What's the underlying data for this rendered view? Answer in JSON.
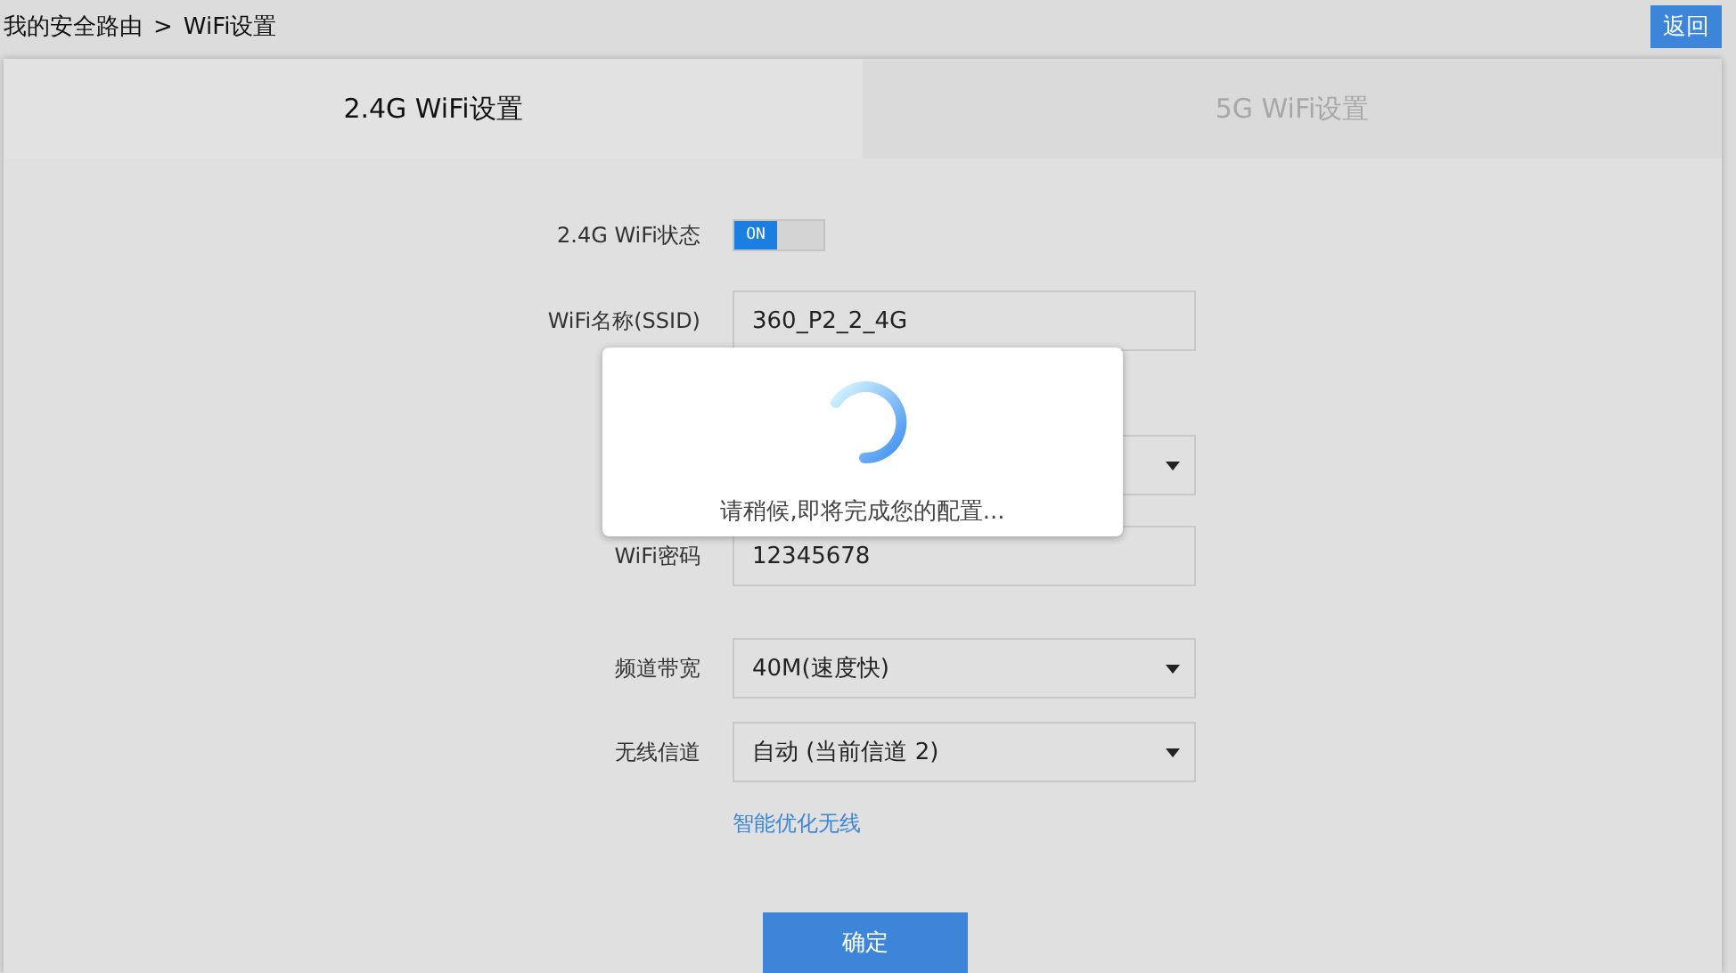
{
  "breadcrumb": {
    "parts": [
      "我的安全路由",
      ">",
      "WiFi设置"
    ]
  },
  "back_button": "返回",
  "tabs": [
    {
      "label": "2.4G WiFi设置",
      "selected": true
    },
    {
      "label": "5G WiFi设置",
      "selected": false
    }
  ],
  "form": [
    {
      "kind": "toggle",
      "label": "2.4G WiFi状态",
      "on": true,
      "on_text": "ON"
    },
    {
      "kind": "text",
      "label": "WiFi名称(SSID)",
      "value": "360_P2_2_4G"
    },
    {
      "kind": "select"
    },
    {
      "kind": "text",
      "label": "WiFi密码",
      "value": "12345678"
    },
    {
      "kind": "select",
      "label": "频道带宽",
      "value": "40M(速度快)"
    },
    {
      "kind": "select",
      "label": "无线信道",
      "value": "自动 (当前信道 2)"
    }
  ],
  "link": "智能优化无线",
  "submit": "确定",
  "loading": {
    "message": "请稍候,即将完成您的配置..."
  }
}
